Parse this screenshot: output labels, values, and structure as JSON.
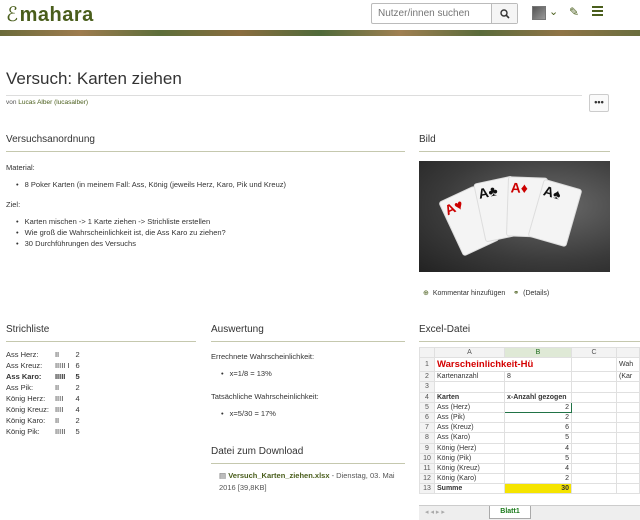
{
  "header": {
    "logo_text": "mahara",
    "search_placeholder": "Nutzer/innen suchen"
  },
  "page": {
    "title": "Versuch: Karten ziehen",
    "by_prefix": "von",
    "author": "Lucas Alber (lucasalber)",
    "more_label": "•••"
  },
  "versuch": {
    "title": "Versuchsanordnung",
    "material_label": "Material:",
    "material_items": [
      "8 Poker Karten (in meinem Fall: Ass, König (jeweils Herz, Karo, Pik und Kreuz)"
    ],
    "ziel_label": "Ziel:",
    "ziel_items": [
      "Karten mischen -> 1 Karte ziehen -> Strichliste erstellen",
      "Wie groß die Wahrscheinlichkeit ist, die Ass Karo zu ziehen?",
      "30 Durchführungen des Versuchs"
    ]
  },
  "bild": {
    "title": "Bild",
    "comment_link": "Kommentar hinzufügen",
    "details_link": "(Details)"
  },
  "strichliste": {
    "title": "Strichliste",
    "rows": [
      {
        "label": "Ass Herz:",
        "marks": "II",
        "count": "2"
      },
      {
        "label": "Ass Kreuz:",
        "marks": "IIIII I",
        "count": "6"
      },
      {
        "label": "Ass Karo:",
        "marks": "IIIII",
        "count": "5"
      },
      {
        "label": "Ass Pik:",
        "marks": "II",
        "count": "2"
      },
      {
        "label": "König Herz:",
        "marks": "IIII",
        "count": "4"
      },
      {
        "label": "König Kreuz:",
        "marks": "IIII",
        "count": "4"
      },
      {
        "label": "König Karo:",
        "marks": "II",
        "count": "2"
      },
      {
        "label": "König Pik:",
        "marks": "IIIII",
        "count": "5"
      }
    ]
  },
  "auswertung": {
    "title": "Auswertung",
    "errechnet_label": "Errechnete Wahrscheinlichkeit:",
    "errechnet_value": "x=1/8 = 13%",
    "tatsaechlich_label": "Tatsächliche Wahrscheinlichkeit:",
    "tatsaechlich_value": "x=5/30 = 17%"
  },
  "download": {
    "title": "Datei zum Download",
    "file_name": "Versuch_Karten_ziehen.xlsx",
    "file_meta": "- Dienstag, 03. Mai 2016 [39,8KB]"
  },
  "excel": {
    "title": "Excel-Datei",
    "columns": [
      "A",
      "B",
      "C"
    ],
    "overflow_col_text_1": "Wah",
    "overflow_col_text_2": "(Kar",
    "sheet_title": "Warscheinlichkeit-Hü",
    "rows": [
      {
        "n": "2",
        "a": "Kartenanzahl",
        "b": "8"
      },
      {
        "n": "3",
        "a": "",
        "b": ""
      },
      {
        "n": "4",
        "a": "Karten",
        "b": "x-Anzahl gezogen"
      },
      {
        "n": "5",
        "a": "Ass (Herz)",
        "b": "2"
      },
      {
        "n": "6",
        "a": "Ass (Pik)",
        "b": "2"
      },
      {
        "n": "7",
        "a": "Ass (Kreuz)",
        "b": "6"
      },
      {
        "n": "8",
        "a": "Ass (Karo)",
        "b": "5"
      },
      {
        "n": "9",
        "a": "König (Herz)",
        "b": "4"
      },
      {
        "n": "10",
        "a": "König (Pik)",
        "b": "5"
      },
      {
        "n": "11",
        "a": "König (Kreuz)",
        "b": "4"
      },
      {
        "n": "12",
        "a": "König (Karo)",
        "b": "2"
      },
      {
        "n": "13",
        "a": "Summe",
        "b": "30"
      }
    ],
    "sheet_tab": "Blatt1",
    "colors": {
      "title_red": "#d40000",
      "highlight_yellow": "#f5e400",
      "accent_green": "#4a5e1c"
    }
  }
}
